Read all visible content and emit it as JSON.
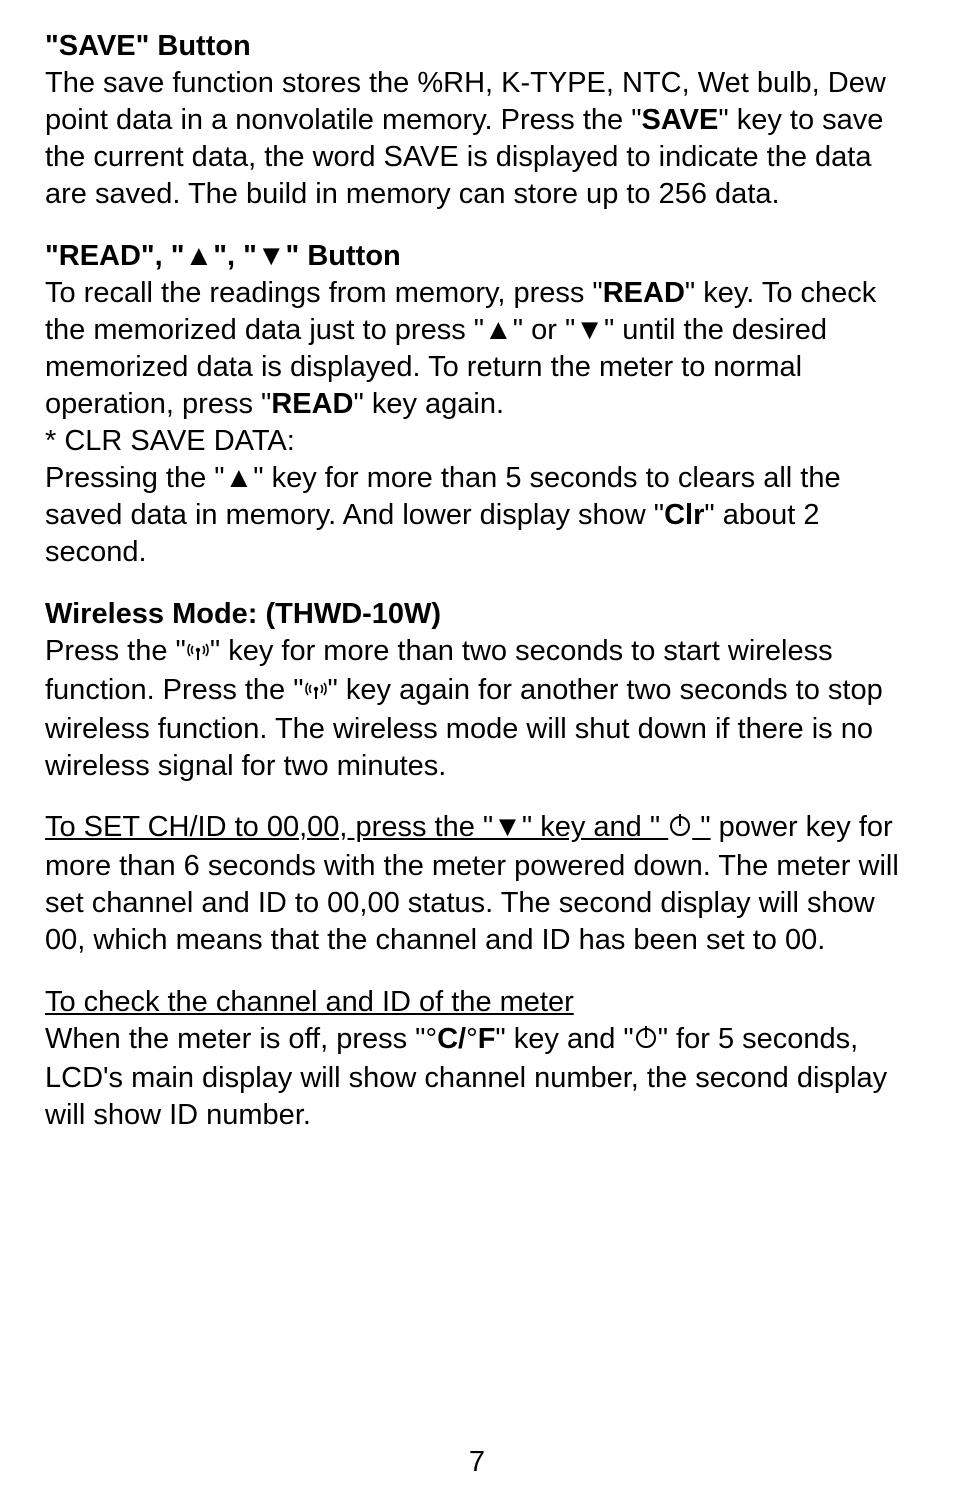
{
  "section1": {
    "heading": "\"SAVE\" Button",
    "p_a": "The save function stores the %RH, K-TYPE, NTC, Wet bulb, Dew point data in a nonvolatile memory. Press the \"",
    "p_b": "SAVE",
    "p_c": "\" key to save the current data, the word SAVE is displayed to indicate the data are saved. The build in memory can store up to 256 data."
  },
  "section2": {
    "heading": "\"READ\", \"▲\", \"▼\" Button",
    "p_a": "To recall the readings from memory, press \"",
    "p_b": "READ",
    "p_c": "\" key. To check the memorized data just to press \"▲\" or \"▼\" until the desired memorized data is displayed. To return the meter to normal operation, press \"",
    "p_d": "READ",
    "p_e": "\" key again.",
    "clr_label": "* CLR SAVE DATA:",
    "clr_a": "Pressing the \"▲\" key for more than 5 seconds to clears all the saved data in memory. And lower display show \"",
    "clr_b": "Clr",
    "clr_c": "\" about 2 second."
  },
  "section3": {
    "heading": "Wireless Mode: (THWD-10W)",
    "p_a": "Press the \"",
    "p_b": "\" key for more than two seconds to start wireless function. Press the \"",
    "p_c": "\" key again for another two seconds to stop wireless function. The wireless mode will shut down if there is no wireless signal for two minutes."
  },
  "section4": {
    "u_a": "To SET CH/ID to 00,00, press the \"▼\" key and \" ",
    "u_b": " \"",
    "p": "power key for more than 6 seconds with the meter powered down. The meter will set channel and ID to 00,00 status. The second display will show 00, which means that the channel and ID has been set to 00."
  },
  "section5": {
    "u": "To check the channel and ID of the meter",
    "p_a": "When the meter is off, press \"°",
    "p_b": "C/",
    "p_c": "°",
    "p_d": "F",
    "p_e": "\" key and \"",
    "p_f": "\" for 5 seconds, LCD's main display will show channel number, the second display will show ID number."
  },
  "page_number": "7"
}
